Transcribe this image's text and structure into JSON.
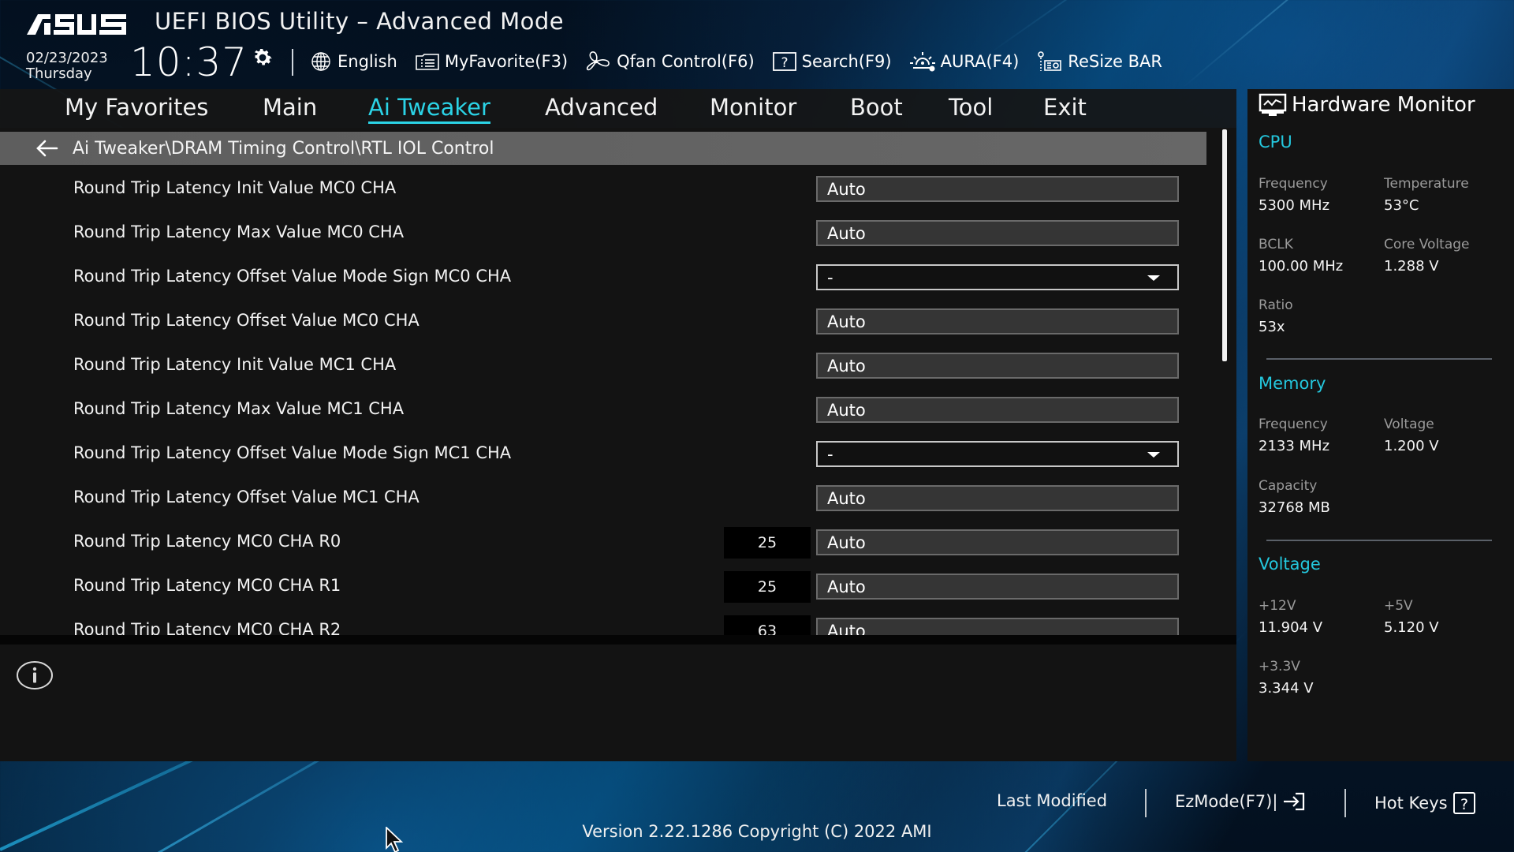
{
  "header": {
    "brand": "ASUS",
    "title": "UEFI BIOS Utility – Advanced Mode",
    "date": "02/23/2023",
    "day": "Thursday",
    "time": "10:37"
  },
  "toolbar": [
    {
      "icon": "globe-icon",
      "label": "English"
    },
    {
      "icon": "favorite-list-icon",
      "label": "MyFavorite(F3)"
    },
    {
      "icon": "fan-icon",
      "label": "Qfan Control(F6)"
    },
    {
      "icon": "question-box-icon",
      "label": "Search(F9)"
    },
    {
      "icon": "aura-light-icon",
      "label": "AURA(F4)"
    },
    {
      "icon": "resize-bar-icon",
      "label": "ReSize BAR"
    }
  ],
  "nav": {
    "active": "Ai Tweaker",
    "items": [
      "My Favorites",
      "Main",
      "Ai Tweaker",
      "Advanced",
      "Monitor",
      "Boot",
      "Tool",
      "Exit"
    ]
  },
  "breadcrumb": "Ai Tweaker\\DRAM Timing Control\\RTL IOL Control",
  "settings": [
    {
      "label": "Round Trip Latency Init Value MC0 CHA",
      "type": "input",
      "value": "Auto"
    },
    {
      "label": "Round Trip Latency Max Value MC0 CHA",
      "type": "input",
      "value": "Auto"
    },
    {
      "label": "Round Trip Latency Offset Value Mode Sign MC0 CHA",
      "type": "dropdown",
      "value": "-"
    },
    {
      "label": "Round Trip Latency Offset Value MC0 CHA",
      "type": "input",
      "value": "Auto"
    },
    {
      "label": "Round Trip Latency Init Value MC1 CHA",
      "type": "input",
      "value": "Auto"
    },
    {
      "label": "Round Trip Latency Max Value MC1 CHA",
      "type": "input",
      "value": "Auto"
    },
    {
      "label": "Round Trip Latency Offset Value Mode Sign MC1 CHA",
      "type": "dropdown",
      "value": "-"
    },
    {
      "label": "Round Trip Latency Offset Value MC1 CHA",
      "type": "input",
      "value": "Auto"
    },
    {
      "label": "Round Trip Latency MC0 CHA R0",
      "type": "input",
      "current": "25",
      "value": "Auto"
    },
    {
      "label": "Round Trip Latency MC0 CHA R1",
      "type": "input",
      "current": "25",
      "value": "Auto"
    },
    {
      "label": "Round Trip Latency MC0 CHA R2",
      "type": "input",
      "current": "63",
      "value": "Auto"
    }
  ],
  "hardware_monitor": {
    "title": "Hardware Monitor",
    "cpu": {
      "title": "CPU",
      "frequency_label": "Frequency",
      "frequency": "5300 MHz",
      "temperature_label": "Temperature",
      "temperature": "53°C",
      "bclk_label": "BCLK",
      "bclk": "100.00 MHz",
      "core_voltage_label": "Core Voltage",
      "core_voltage": "1.288 V",
      "ratio_label": "Ratio",
      "ratio": "53x"
    },
    "memory": {
      "title": "Memory",
      "frequency_label": "Frequency",
      "frequency": "2133 MHz",
      "voltage_label": "Voltage",
      "voltage": "1.200 V",
      "capacity_label": "Capacity",
      "capacity": "32768 MB"
    },
    "voltage": {
      "title": "Voltage",
      "v12_label": "+12V",
      "v12": "11.904 V",
      "v5_label": "+5V",
      "v5": "5.120 V",
      "v33_label": "+3.3V",
      "v33": "3.344 V"
    }
  },
  "footer": {
    "last_modified": "Last Modified",
    "ezmode": "EzMode(F7)|",
    "hot_keys": "Hot Keys",
    "version": "Version 2.22.1286 Copyright (C) 2022 AMI"
  },
  "colors": {
    "accent": "#2bd3e6",
    "panel": "#131313",
    "breadcrumb": "#636363",
    "value_box": "#353535"
  }
}
